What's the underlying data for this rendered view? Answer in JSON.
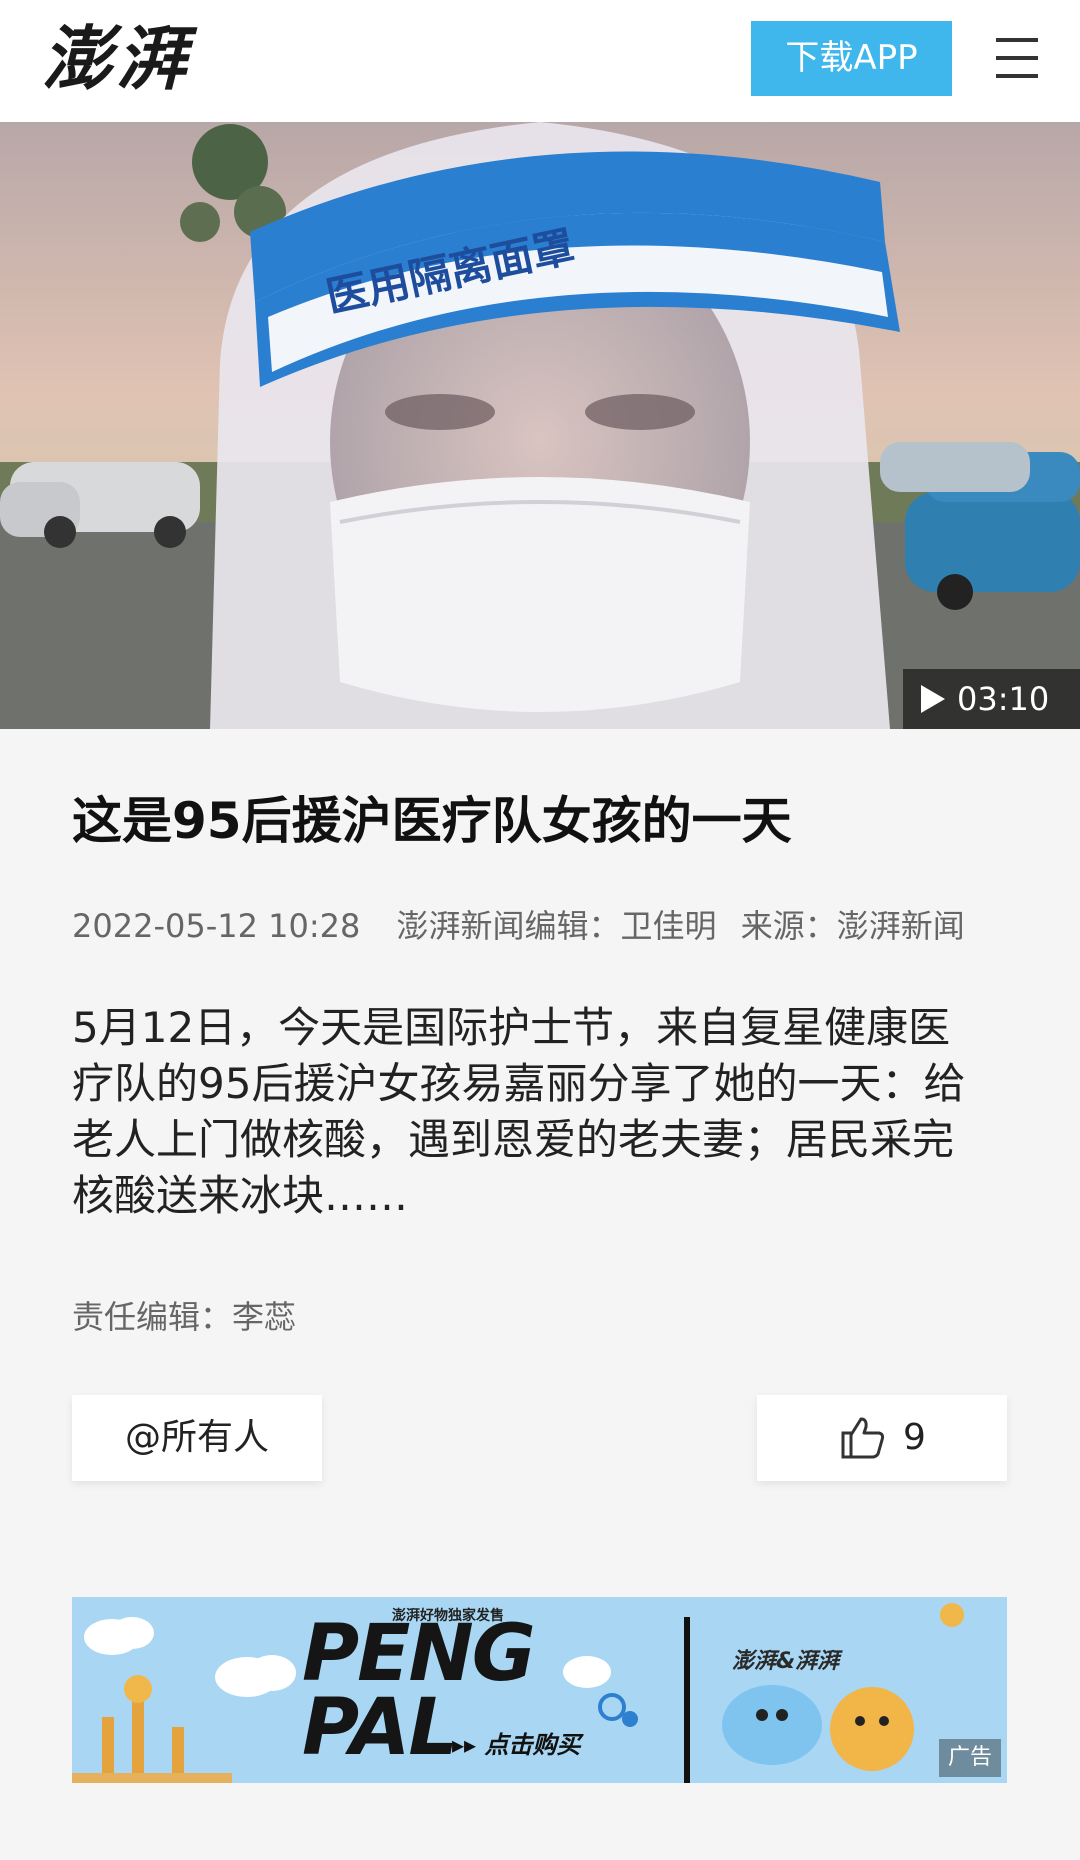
{
  "header": {
    "logo_text": "澎湃",
    "download_label": "下载APP",
    "menu_icon": "menu-icon"
  },
  "video": {
    "duration": "03:10",
    "face_shield_text": "医用隔离面罩"
  },
  "article": {
    "title": "这是95后援沪医疗队女孩的一天",
    "date": "2022-05-12 10:28",
    "editor_info": "澎湃新闻编辑：卫佳明",
    "source": "来源：澎湃新闻",
    "summary": "5月12日，今天是国际护士节，来自复星健康医疗队的95后援沪女孩易嘉丽分享了她的一天：给老人上门做核酸，遇到恩爱的老夫妻；居民采完核酸送来冰块……",
    "responsible_editor": "责任编辑：李蕊"
  },
  "actions": {
    "mention_label": "@所有人",
    "like_count": "9"
  },
  "ad": {
    "tagline": "澎湃好物独家发售",
    "brand_line1": "PENG",
    "brand_line2": "PAL",
    "buy_label": "点击购买",
    "collab_text": "澎湃&湃湃",
    "ad_label": "广告"
  },
  "colors": {
    "download_button": "#3fb6ec",
    "background": "#f5f5f5",
    "ad_background": "#a9d7f3"
  }
}
